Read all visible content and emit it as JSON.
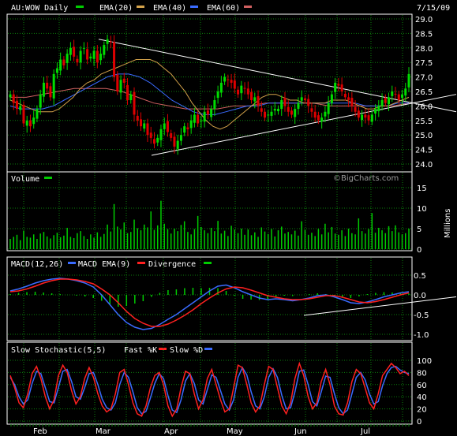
{
  "colors": {
    "background": "#000000",
    "border": "#ffffff",
    "grid": "#0b7f0b",
    "candle_up": "#00dd00",
    "candle_down": "#dd0000",
    "ema20": "#d4a24a",
    "ema40": "#3a6bff",
    "ema60": "#d06060",
    "trend": "#ffffff",
    "volume": "#00cc00",
    "macd": "#3a6bff",
    "macd_ema": "#ff2020",
    "divergence": "#00cc00",
    "fast_k": "#ff2020",
    "slow_d": "#3a6bff",
    "legend_swatch_green": "#00cc00"
  },
  "header": {
    "symbol_label": "AU:WOW Daily",
    "ema20_label": "EMA(20)",
    "ema40_label": "EMA(40)",
    "ema60_label": "EMA(60)",
    "date": "7/15/09"
  },
  "watermark": "©BigCharts.com",
  "panels": {
    "volume_label": "Volume",
    "volume_axis_title": "Millions",
    "macd_label": "MACD(12,26)",
    "macd_ema_label": "MACD EMA(9)",
    "divergence_label": "Divergence",
    "stoch_label": "Slow Stochastic(5,5)",
    "fast_k_label": "Fast %K",
    "slow_d_label": "Slow %D"
  },
  "chart_data": [
    {
      "type": "candlestick",
      "title": "AU:WOW Daily",
      "x_labels": [
        "Feb",
        "Mar",
        "Apr",
        "May",
        "Jun",
        "Jul"
      ],
      "ylim": [
        24.0,
        29.0
      ],
      "y_ticks": [
        "29.0",
        "28.5",
        "28.0",
        "27.5",
        "27.0",
        "26.5",
        "26.0",
        "25.5",
        "25.0",
        "24.5",
        "24.0"
      ],
      "grid": true,
      "series": [
        {
          "name": "EMA(20)"
        },
        {
          "name": "EMA(40)"
        },
        {
          "name": "EMA(60)"
        }
      ],
      "closes": [
        26.4,
        26.1,
        25.9,
        26.0,
        25.4,
        25.5,
        25.3,
        25.6,
        25.9,
        26.4,
        26.8,
        26.6,
        26.3,
        27.1,
        27.3,
        27.6,
        27.4,
        27.8,
        28.0,
        27.7,
        27.5,
        27.9,
        28.0,
        27.6,
        27.7,
        27.9,
        27.5,
        27.8,
        28.1,
        28.3,
        28.2,
        27.0,
        26.5,
        26.9,
        26.8,
        26.2,
        26.4,
        25.7,
        25.5,
        25.3,
        25.4,
        25.0,
        24.9,
        24.7,
        24.9,
        25.2,
        25.4,
        25.1,
        24.9,
        24.6,
        24.8,
        25.0,
        25.3,
        25.2,
        25.5,
        25.7,
        25.4,
        25.5,
        25.8,
        25.7,
        25.9,
        26.2,
        26.5,
        26.8,
        27.0,
        26.9,
        26.8,
        26.6,
        26.4,
        26.7,
        26.6,
        26.4,
        26.2,
        26.3,
        26.0,
        25.8,
        25.6,
        25.7,
        25.8,
        25.9,
        25.9,
        26.2,
        26.0,
        25.8,
        25.7,
        25.9,
        26.1,
        26.3,
        26.2,
        26.0,
        25.8,
        25.6,
        25.5,
        25.6,
        25.8,
        26.1,
        26.4,
        26.8,
        26.7,
        26.5,
        26.3,
        26.2,
        26.0,
        25.8,
        25.6,
        25.7,
        25.6,
        25.5,
        25.7,
        25.9,
        26.0,
        26.2,
        26.1,
        26.3,
        26.5,
        26.4,
        26.2,
        26.4,
        26.6,
        27.1
      ],
      "ema20": [
        26.2,
        26.1,
        26.0,
        25.9,
        25.8,
        25.8,
        25.8,
        25.9,
        26.1,
        26.3,
        26.6,
        26.8,
        26.9,
        27.1,
        27.2,
        27.3,
        27.4,
        27.5,
        27.6,
        27.6,
        27.6,
        27.5,
        27.3,
        27.1,
        26.8,
        26.5,
        26.1,
        25.8,
        25.5,
        25.3,
        25.2,
        25.3,
        25.5,
        25.7,
        25.9,
        26.1,
        26.3,
        26.4,
        26.4,
        26.3,
        26.2,
        26.2,
        26.1,
        26.1,
        26.1,
        26.1,
        26.2,
        26.2,
        26.2,
        26.1,
        26.0,
        25.9,
        25.9,
        26.0,
        26.0,
        26.1,
        26.2,
        26.3
      ],
      "ema40": [
        26.0,
        25.9,
        25.9,
        25.9,
        26.0,
        26.2,
        26.4,
        26.6,
        26.8,
        27.0,
        27.1,
        27.1,
        27.0,
        26.8,
        26.5,
        26.2,
        26.0,
        25.8,
        25.7,
        25.7,
        25.8,
        25.9,
        26.0,
        26.0,
        26.1,
        26.1,
        26.1,
        26.1,
        26.1,
        26.1,
        26.1,
        26.1,
        26.1,
        26.0,
        26.0,
        26.0,
        26.1,
        26.1
      ],
      "ema60": [
        26.3,
        26.3,
        26.4,
        26.5,
        26.6,
        26.6,
        26.6,
        26.5,
        26.3,
        26.1,
        26.0,
        25.9,
        25.9,
        25.9,
        26.0,
        26.0,
        26.1,
        26.1,
        26.1,
        26.1,
        26.0,
        26.0,
        26.0,
        26.0,
        26.0,
        26.1
      ],
      "trendlines": [
        {
          "from": [
            28.3,
            "Mar"
          ],
          "to_price": 26.0,
          "note": "descending resistance"
        },
        {
          "from": [
            24.3,
            "Mar"
          ],
          "to_price": 26.2,
          "note": "ascending support"
        }
      ]
    },
    {
      "type": "bar",
      "title": "Volume",
      "ylabel": "Millions",
      "ylim": [
        0,
        15
      ],
      "y_ticks": [
        "15",
        "10",
        "5",
        "0"
      ],
      "values": [
        2.5,
        3.0,
        3.5,
        2.2,
        4.5,
        3.0,
        2.8,
        3.6,
        2.5,
        3.8,
        4.2,
        3.1,
        2.6,
        3.4,
        4.0,
        2.9,
        3.3,
        5.2,
        3.0,
        2.7,
        3.9,
        4.4,
        3.2,
        2.5,
        3.6,
        2.8,
        4.1,
        3.0,
        3.7,
        6.0,
        4.3,
        11.0,
        5.5,
        4.8,
        6.5,
        3.9,
        4.2,
        7.2,
        5.1,
        4.6,
        6.0,
        5.3,
        9.2,
        4.7,
        5.8,
        11.8,
        6.2,
        4.9,
        3.8,
        5.0,
        4.4,
        5.9,
        6.8,
        4.2,
        3.6,
        4.9,
        8.1,
        5.4,
        4.6,
        3.9,
        5.2,
        4.4,
        6.9,
        3.8,
        4.5,
        3.2,
        5.7,
        4.8,
        3.9,
        5.0,
        3.5,
        4.8,
        3.4,
        4.1,
        3.0,
        5.3,
        4.3,
        3.7,
        4.9,
        3.1,
        4.6,
        5.5,
        3.8,
        4.2,
        3.6,
        4.5,
        3.3,
        6.8,
        4.7,
        3.5,
        4.0,
        3.2,
        4.9,
        3.6,
        6.2,
        4.1,
        5.4,
        3.8,
        3.5,
        4.6,
        3.2,
        5.0,
        3.9,
        3.6,
        7.5,
        4.4,
        3.8,
        4.9,
        8.8,
        4.0,
        5.2,
        4.6,
        3.9,
        5.6,
        4.4,
        5.8,
        4.1,
        3.6,
        3.9,
        5.0
      ]
    },
    {
      "type": "line",
      "title": "MACD(12,26)",
      "ylim": [
        -1.0,
        0.5
      ],
      "y_ticks": [
        "0.5",
        "0.0",
        "-0.5",
        "-1.0"
      ],
      "series": [
        {
          "name": "MACD(12,26)",
          "values": [
            0.1,
            0.15,
            0.22,
            0.3,
            0.36,
            0.4,
            0.42,
            0.4,
            0.36,
            0.3,
            0.2,
            0.0,
            -0.25,
            -0.5,
            -0.7,
            -0.82,
            -0.88,
            -0.85,
            -0.75,
            -0.62,
            -0.5,
            -0.35,
            -0.2,
            -0.05,
            0.1,
            0.22,
            0.25,
            0.18,
            0.08,
            0.0,
            -0.08,
            -0.12,
            -0.1,
            -0.12,
            -0.15,
            -0.12,
            -0.08,
            -0.02,
            0.0,
            -0.05,
            -0.12,
            -0.2,
            -0.22,
            -0.18,
            -0.12,
            -0.05,
            0.0,
            0.05,
            0.08
          ]
        },
        {
          "name": "MACD EMA(9)",
          "values": [
            0.08,
            0.1,
            0.15,
            0.22,
            0.3,
            0.36,
            0.4,
            0.4,
            0.38,
            0.34,
            0.28,
            0.15,
            0.0,
            -0.2,
            -0.42,
            -0.6,
            -0.72,
            -0.8,
            -0.8,
            -0.74,
            -0.64,
            -0.52,
            -0.38,
            -0.22,
            -0.08,
            0.05,
            0.15,
            0.2,
            0.18,
            0.12,
            0.05,
            -0.02,
            -0.06,
            -0.1,
            -0.12,
            -0.12,
            -0.1,
            -0.06,
            -0.02,
            -0.02,
            -0.06,
            -0.12,
            -0.18,
            -0.2,
            -0.17,
            -0.12,
            -0.06,
            0.0,
            0.05
          ]
        },
        {
          "name": "Divergence",
          "values": [
            0.02,
            0.05,
            0.07,
            0.08,
            0.06,
            0.04,
            0.02,
            0.0,
            -0.02,
            -0.04,
            -0.08,
            -0.15,
            -0.25,
            -0.3,
            -0.28,
            -0.22,
            -0.16,
            -0.05,
            0.05,
            0.12,
            0.14,
            0.17,
            0.18,
            0.17,
            0.18,
            0.17,
            0.1,
            -0.02,
            -0.1,
            -0.12,
            -0.13,
            -0.1,
            -0.04,
            -0.02,
            -0.03,
            0.0,
            0.02,
            0.04,
            0.02,
            -0.03,
            -0.06,
            -0.08,
            -0.04,
            0.02,
            0.05,
            0.07,
            0.06,
            0.05,
            0.03
          ]
        }
      ]
    },
    {
      "type": "line",
      "title": "Slow Stochastic(5,5)",
      "ylim": [
        0,
        100
      ],
      "y_ticks": [
        "100",
        "80",
        "60",
        "40",
        "20",
        "0"
      ],
      "series": [
        {
          "name": "Fast %K",
          "values": [
            75,
            55,
            30,
            22,
            45,
            78,
            90,
            70,
            40,
            20,
            35,
            75,
            92,
            80,
            50,
            28,
            40,
            70,
            88,
            72,
            45,
            25,
            15,
            20,
            45,
            80,
            85,
            60,
            30,
            12,
            8,
            25,
            55,
            75,
            80,
            60,
            25,
            8,
            20,
            55,
            82,
            78,
            45,
            20,
            35,
            70,
            85,
            60,
            35,
            15,
            20,
            55,
            92,
            88,
            60,
            30,
            15,
            25,
            60,
            90,
            85,
            55,
            25,
            12,
            30,
            70,
            95,
            75,
            40,
            20,
            30,
            65,
            85,
            60,
            25,
            12,
            10,
            30,
            65,
            85,
            78,
            55,
            30,
            20,
            45,
            75,
            85,
            95,
            88,
            78,
            82,
            75
          ]
        },
        {
          "name": "Slow %D",
          "values": [
            72,
            60,
            40,
            28,
            35,
            62,
            82,
            78,
            55,
            32,
            30,
            55,
            82,
            85,
            65,
            40,
            36,
            55,
            78,
            80,
            60,
            36,
            22,
            18,
            30,
            60,
            80,
            72,
            48,
            22,
            12,
            16,
            38,
            62,
            78,
            70,
            42,
            18,
            14,
            35,
            66,
            78,
            62,
            35,
            28,
            52,
            76,
            72,
            50,
            28,
            18,
            35,
            72,
            88,
            76,
            48,
            25,
            20,
            40,
            72,
            86,
            72,
            42,
            20,
            22,
            48,
            82,
            84,
            60,
            32,
            25,
            48,
            74,
            72,
            45,
            22,
            12,
            18,
            45,
            72,
            80,
            68,
            45,
            28,
            32,
            58,
            78,
            88,
            90,
            84,
            80,
            78
          ]
        }
      ]
    }
  ]
}
